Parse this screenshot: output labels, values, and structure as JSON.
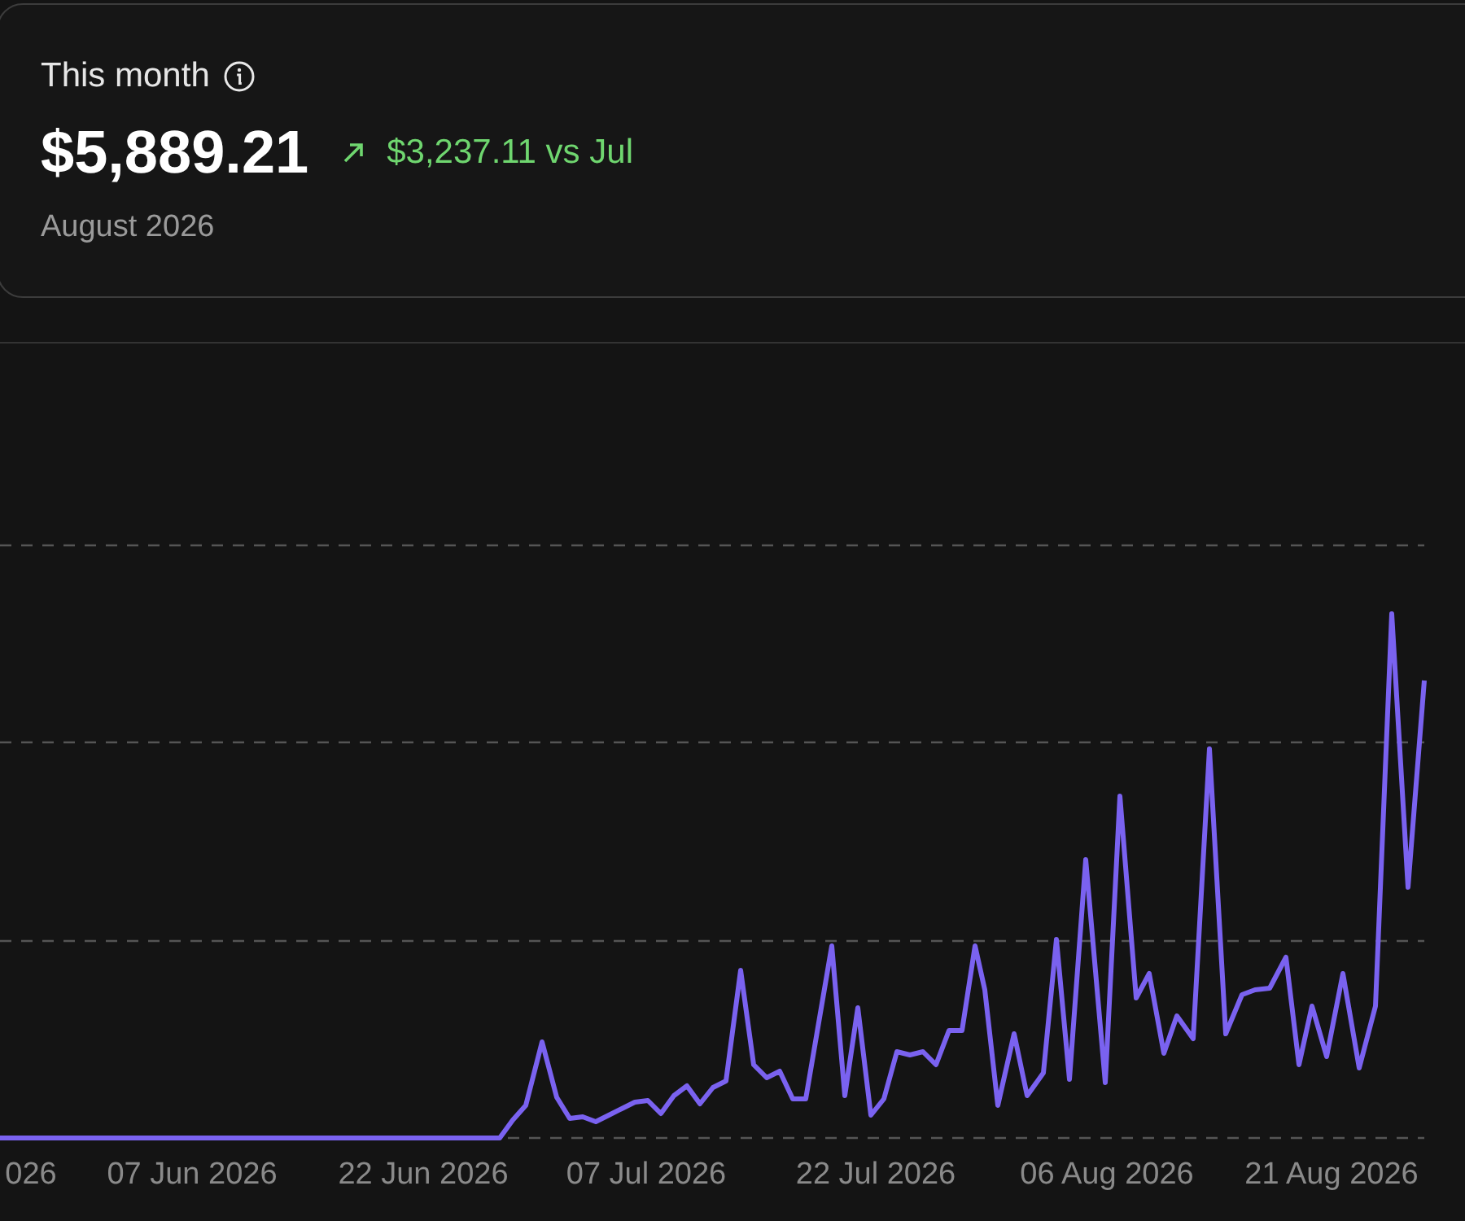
{
  "summary": {
    "label": "This month",
    "amount": "$5,889.21",
    "change": "$3,237.11 vs Jul",
    "period": "August 2026"
  },
  "chart": {
    "x_labels": [
      "026",
      "07 Jun 2026",
      "22 Jun 2026",
      "07 Jul 2026",
      "22 Jul 2026",
      "06 Aug 2026",
      "21 Aug 2026"
    ]
  }
}
